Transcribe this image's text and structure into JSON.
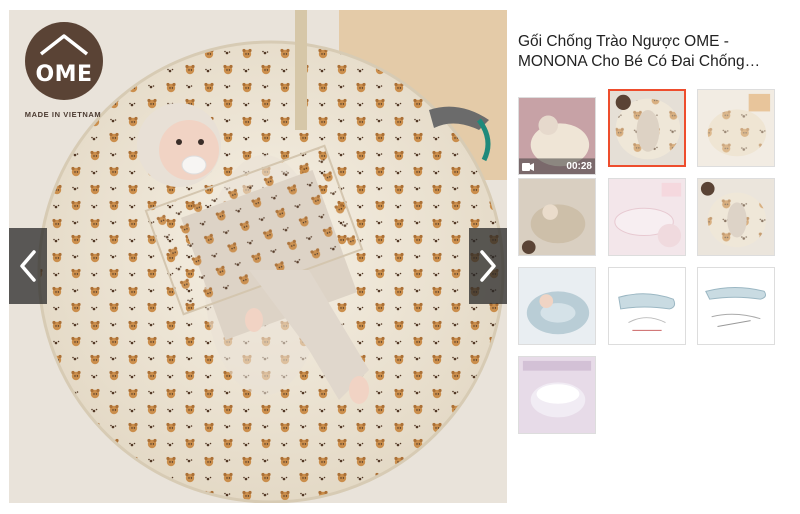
{
  "product": {
    "title_line1": "Gối Chống Trào Ngược OME -",
    "title_line2": "MONONA Cho Bé Có Đai Chống…"
  },
  "logo": {
    "brand": "OME",
    "caption": "MADE IN VIETNAM"
  },
  "gallery": {
    "prev_icon": "chevron-left-icon",
    "next_icon": "chevron-right-icon",
    "active_index": 1,
    "thumbnails": [
      {
        "kind": "video",
        "duration": "00:28"
      },
      {
        "kind": "image"
      },
      {
        "kind": "image"
      },
      {
        "kind": "image"
      },
      {
        "kind": "image"
      },
      {
        "kind": "image"
      },
      {
        "kind": "image"
      },
      {
        "kind": "image"
      },
      {
        "kind": "image"
      },
      {
        "kind": "image"
      }
    ]
  },
  "colors": {
    "accent": "#ee4d2d",
    "logo_bg": "#5a4335",
    "pillow": "#efe7d8",
    "nav_bg": "#2b2b2b"
  }
}
